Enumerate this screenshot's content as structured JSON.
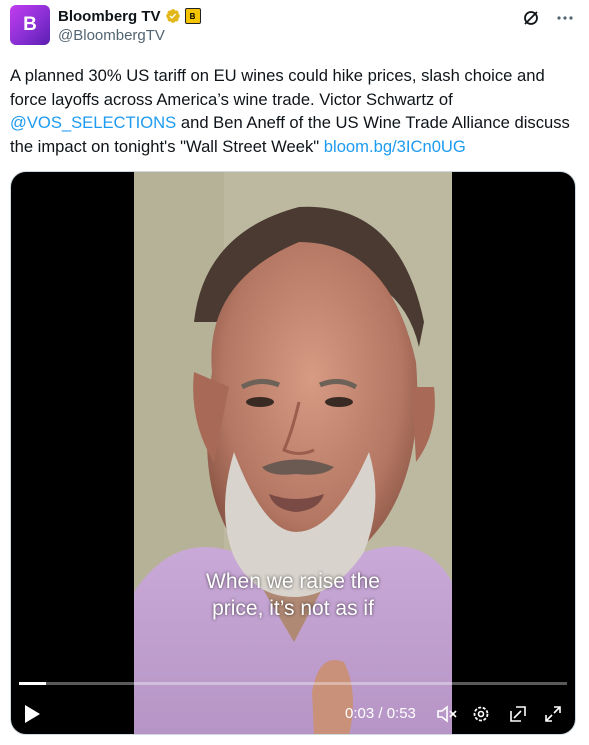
{
  "author": {
    "avatar_letter": "B",
    "display_name": "Bloomberg TV",
    "handle": "@BloombergTV",
    "affiliate_badge_letter": "B"
  },
  "tweet": {
    "text_part1": "A planned 30% US tariff on EU wines could hike prices, slash choice and force layoffs across America’s wine trade. Victor Schwartz of ",
    "mention": "@VOS_SELECTIONS",
    "text_part2": " and Ben Aneff of the US Wine Trade Alliance discuss the impact on tonight's \"Wall Street Week\" ",
    "link": "bloom.bg/3ICn0UG"
  },
  "video": {
    "subtitle_line1": "When we raise the",
    "subtitle_line2": "price, it’s not as if",
    "current_time": "0:03",
    "duration": "0:53",
    "time_display": "0:03 / 0:53",
    "progress_fraction": 0.05
  },
  "colors": {
    "link": "#1d9bf0",
    "avatar": "#a435e0",
    "verified": "#e2b719"
  }
}
